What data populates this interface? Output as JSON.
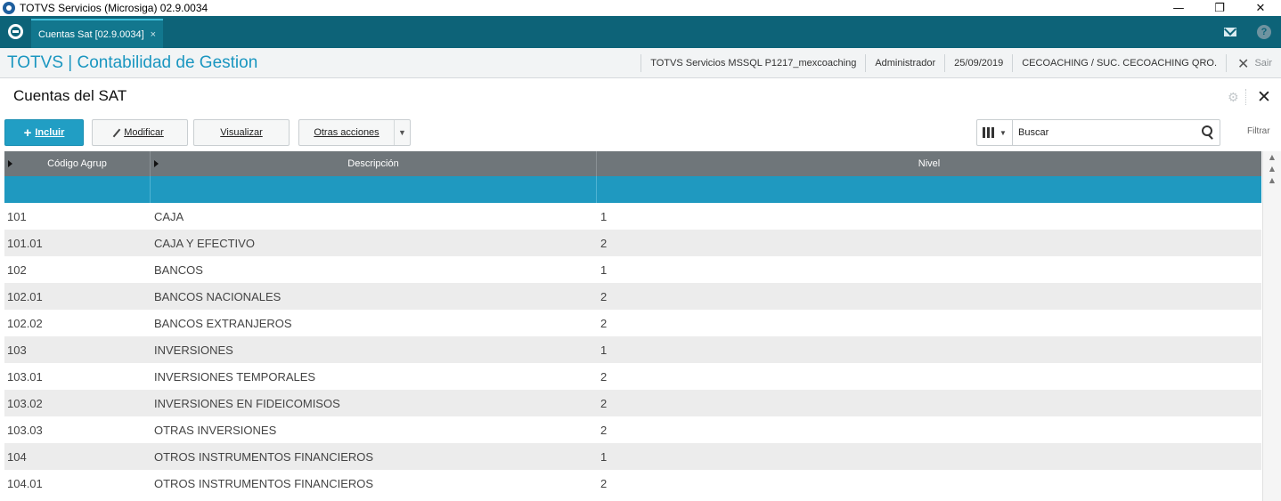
{
  "window": {
    "title": "TOTVS Servicios (Microsiga) 02.9.0034",
    "minimize": "—",
    "restore": "❐",
    "close": "✕"
  },
  "tabbar": {
    "tab_label": "Cuentas Sat [02.9.0034]",
    "tab_close": "×",
    "help": "?"
  },
  "module": {
    "title": "TOTVS | Contabilidad de Gestion",
    "server": "TOTVS Servicios MSSQL P1217_mexcoaching",
    "user": "Administrador",
    "date": "25/09/2019",
    "branch": "CECOACHING / SUC. CECOACHING QRO.",
    "exit_label": "Sair",
    "exit_icon": "✕"
  },
  "page": {
    "title": "Cuentas del SAT",
    "gear": "⚙",
    "close": "✕"
  },
  "toolbar": {
    "incluir": "Incluir",
    "modificar": "Modificar",
    "visualizar": "Visualizar",
    "otras": "Otras acciones",
    "otras_arrow": "▼",
    "caret": "▼",
    "search_placeholder": "Buscar",
    "filtrar": "Filtrar"
  },
  "grid": {
    "columns": [
      "Código Agrup",
      "Descripción",
      "Nivel"
    ],
    "rows": [
      [
        "101",
        "CAJA",
        "1"
      ],
      [
        "101.01",
        "CAJA Y EFECTIVO",
        "2"
      ],
      [
        "102",
        "BANCOS",
        "1"
      ],
      [
        "102.01",
        "BANCOS NACIONALES",
        "2"
      ],
      [
        "102.02",
        "BANCOS EXTRANJEROS",
        "2"
      ],
      [
        "103",
        "INVERSIONES",
        "1"
      ],
      [
        "103.01",
        "INVERSIONES TEMPORALES",
        "2"
      ],
      [
        "103.02",
        "INVERSIONES EN FIDEICOMISOS",
        "2"
      ],
      [
        "103.03",
        "OTRAS INVERSIONES",
        "2"
      ],
      [
        "104",
        "OTROS INSTRUMENTOS FINANCIEROS",
        "1"
      ],
      [
        "104.01",
        "OTROS INSTRUMENTOS FINANCIEROS",
        "2"
      ]
    ]
  },
  "scroll": {
    "top": "▲",
    "up_double": "▲",
    "up": "▲"
  },
  "colors": {
    "tabbar": "#0d6378",
    "accent": "#1f99c0",
    "title_blue": "#1a96c0",
    "header_gray": "#6f767a"
  }
}
